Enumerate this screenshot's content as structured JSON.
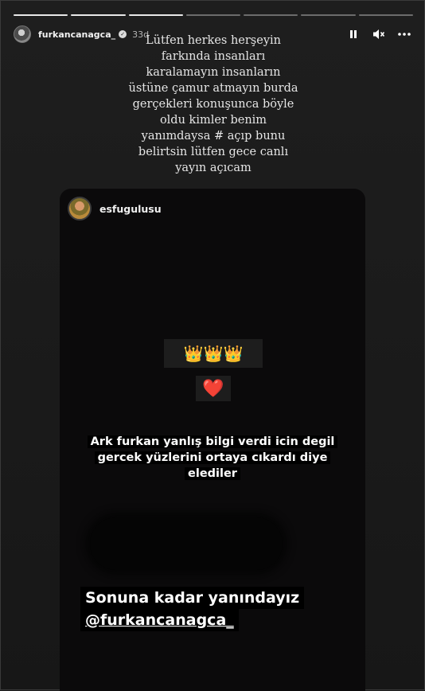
{
  "story": {
    "progress": {
      "segments": 7,
      "completed": 3
    },
    "header": {
      "username": "furkancanagca_",
      "verified": true,
      "time": "33d",
      "controls": [
        "pause-icon",
        "mute-icon",
        "more-icon"
      ]
    },
    "caption": "Lütfen herkes herşeyin\nfarkında insanları\nkaralamayın insanların\nüstüne çamur atmayın burda\ngerçekleri konuşunca böyle\noldu kimler benim\nyanımdaysa # açıp bunu\nbelirtsin lütfen gece canlı\nyayın açıcam"
  },
  "shared_post": {
    "username": "esfugulusu",
    "crowns": "👑👑👑",
    "heart": "❤️",
    "text_line1": "Ark furkan yanlış bilgi verdi icin degil",
    "text_line2": "gercek yüzlerini ortaya cıkardı diye",
    "text_line3": "elediler",
    "cta_line1": "Sonuna kadar yanındayız",
    "cta_mention": "@furkancanagca_"
  },
  "colors": {
    "background": "#1b1b1b",
    "post_background": "#0b0a0b",
    "heart": "#e8343e"
  }
}
